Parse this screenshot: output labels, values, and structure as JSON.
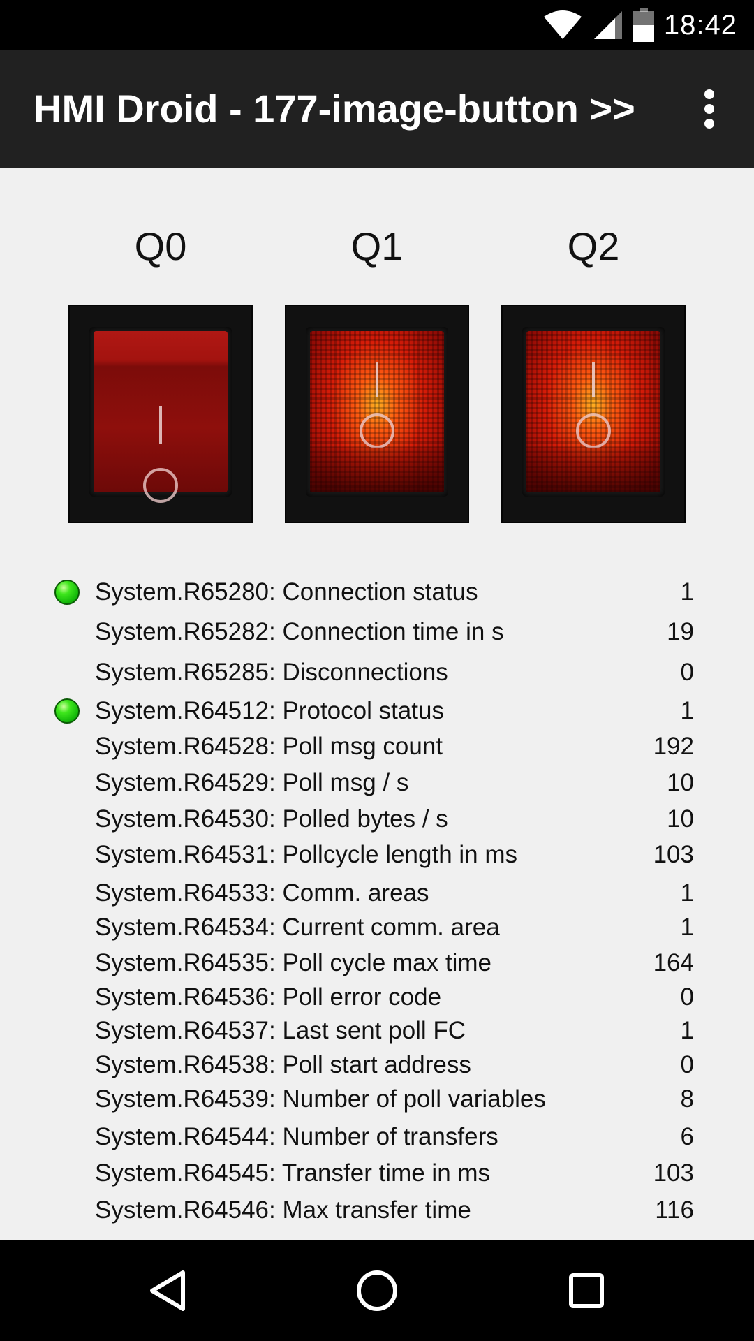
{
  "status_bar": {
    "time": "18:42",
    "icons": [
      "wifi-icon",
      "cell-signal-icon",
      "battery-icon"
    ]
  },
  "app_bar": {
    "title": "HMI Droid - 177-image-button >>",
    "overflow_icon": "more-vert-icon"
  },
  "switches": [
    {
      "label": "Q0",
      "state": "off"
    },
    {
      "label": "Q1",
      "state": "on"
    },
    {
      "label": "Q2",
      "state": "on"
    }
  ],
  "status_rows": [
    {
      "label": "System.R65280: Connection status",
      "value": "1",
      "led": true
    },
    {
      "label": "System.R65282: Connection time in s",
      "value": "19",
      "led": false
    },
    {
      "label": "System.R65285: Disconnections",
      "value": "0",
      "led": false
    },
    {
      "label": "System.R64512: Protocol status",
      "value": "1",
      "led": true
    },
    {
      "label": "System.R64528: Poll msg count",
      "value": "192",
      "led": false
    },
    {
      "label": "System.R64529: Poll msg / s",
      "value": "10",
      "led": false
    },
    {
      "label": "System.R64530: Polled bytes / s",
      "value": "10",
      "led": false
    },
    {
      "label": "System.R64531: Pollcycle length in ms",
      "value": "103",
      "led": false
    },
    {
      "label": "System.R64533: Comm. areas",
      "value": "1",
      "led": false
    },
    {
      "label": "System.R64534: Current comm. area",
      "value": "1",
      "led": false
    },
    {
      "label": "System.R64535: Poll cycle max time",
      "value": "164",
      "led": false
    },
    {
      "label": "System.R64536: Poll error code",
      "value": "0",
      "led": false
    },
    {
      "label": "System.R64537: Last sent poll FC",
      "value": "1",
      "led": false
    },
    {
      "label": "System.R64538: Poll start address",
      "value": "0",
      "led": false
    },
    {
      "label": "System.R64539: Number of poll variables",
      "value": "8",
      "led": false
    },
    {
      "label": "System.R64544: Number of transfers",
      "value": "6",
      "led": false
    },
    {
      "label": "System.R64545: Transfer time in ms",
      "value": "103",
      "led": false
    },
    {
      "label": "System.R64546: Max transfer time",
      "value": "116",
      "led": false
    }
  ],
  "nav_bar": {
    "back_icon": "back-icon",
    "home_icon": "home-icon",
    "recents_icon": "recents-icon"
  }
}
